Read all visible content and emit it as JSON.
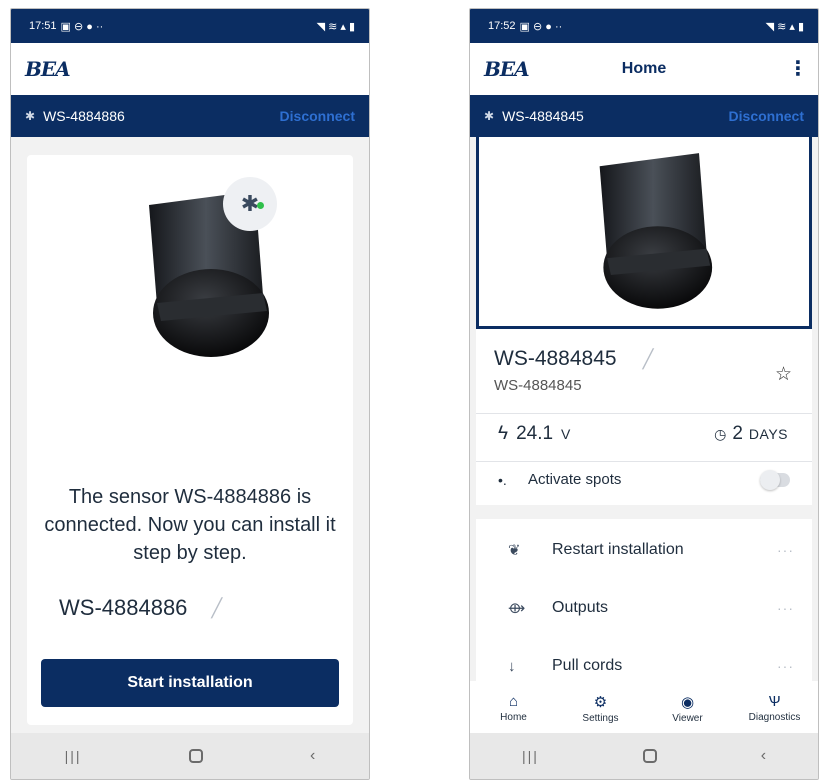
{
  "left": {
    "status": {
      "time": "17:51",
      "left_icons": "▣ ⊖ ● ··",
      "right_icons": "◥ ≋ ▴ ▮"
    },
    "logo": "BEA",
    "connection": {
      "device": "WS-4884886",
      "disconnect_label": "Disconnect"
    },
    "message": "The sensor WS-4884886 is connected. Now you can install it step by step.",
    "sensor_name": "WS-4884886",
    "start_button": "Start installation"
  },
  "right": {
    "status": {
      "time": "17:52",
      "left_icons": "▣ ⊖ ● ··",
      "right_icons": "◥ ≋ ▴ ▮"
    },
    "logo": "BEA",
    "title": "Home",
    "connection": {
      "device": "WS-4884845",
      "disconnect_label": "Disconnect"
    },
    "device": {
      "name": "WS-4884845",
      "subtitle": "WS-4884845"
    },
    "stats": {
      "voltage": "24.1",
      "voltage_unit": "V",
      "uptime": "2",
      "uptime_unit": "DAYS"
    },
    "spots_label": "Activate spots",
    "spots_enabled": false,
    "menu": [
      {
        "label": "Restart installation",
        "icon": "restart-icon"
      },
      {
        "label": "Outputs",
        "icon": "outputs-icon"
      },
      {
        "label": "Pull cords",
        "icon": "pull-cord-icon"
      }
    ],
    "tabs": [
      {
        "label": "Home",
        "icon": "home-icon"
      },
      {
        "label": "Settings",
        "icon": "gear-icon"
      },
      {
        "label": "Viewer",
        "icon": "eye-icon"
      },
      {
        "label": "Diagnostics",
        "icon": "stethoscope-icon"
      }
    ]
  },
  "colors": {
    "brand": "#0b2d62",
    "link": "#2e6fd1",
    "status_connected": "#2fbf4a"
  }
}
